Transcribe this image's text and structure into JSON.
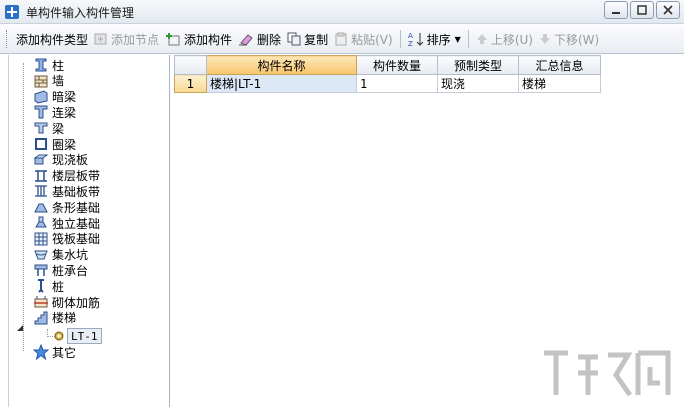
{
  "window": {
    "title": "单构件输入构件管理"
  },
  "toolbar": {
    "add_type": "添加构件类型",
    "add_node": "添加节点",
    "add_component": "添加构件",
    "delete": "删除",
    "copy": "复制",
    "paste": "粘贴(V)",
    "sort": "排序",
    "move_up": "上移(U)",
    "move_down": "下移(W)"
  },
  "tree": {
    "items": [
      {
        "label": "柱",
        "icon": "column-icon"
      },
      {
        "label": "墙",
        "icon": "wall-icon"
      },
      {
        "label": "暗梁",
        "icon": "hidden-beam-icon"
      },
      {
        "label": "连梁",
        "icon": "coupling-beam-icon"
      },
      {
        "label": "梁",
        "icon": "beam-icon"
      },
      {
        "label": "圈梁",
        "icon": "ring-beam-icon"
      },
      {
        "label": "现浇板",
        "icon": "slab-icon"
      },
      {
        "label": "楼层板带",
        "icon": "floor-strip-icon"
      },
      {
        "label": "基础板带",
        "icon": "foundation-strip-icon"
      },
      {
        "label": "条形基础",
        "icon": "strip-foundation-icon"
      },
      {
        "label": "独立基础",
        "icon": "isolated-foundation-icon"
      },
      {
        "label": "筏板基础",
        "icon": "raft-foundation-icon"
      },
      {
        "label": "集水坑",
        "icon": "sump-icon"
      },
      {
        "label": "桩承台",
        "icon": "pile-cap-icon"
      },
      {
        "label": "桩",
        "icon": "pile-icon"
      },
      {
        "label": "砌体加筋",
        "icon": "masonry-rebar-icon"
      },
      {
        "label": "楼梯",
        "icon": "stair-icon"
      }
    ],
    "child": {
      "label": "LT-1",
      "icon": "gear-icon"
    },
    "last": {
      "label": "其它",
      "icon": "star-icon"
    }
  },
  "grid": {
    "headers": [
      "构件名称",
      "构件数量",
      "预制类型",
      "汇总信息"
    ],
    "rows": [
      {
        "num": "1",
        "name": "楼梯|LT-1",
        "qty": "1",
        "type": "现浇",
        "summary": "楼梯"
      }
    ]
  },
  "colors": {
    "header_active": "#f7c56d",
    "row_selected": "#dce8f6",
    "titlebar": "#e3e8ef"
  }
}
